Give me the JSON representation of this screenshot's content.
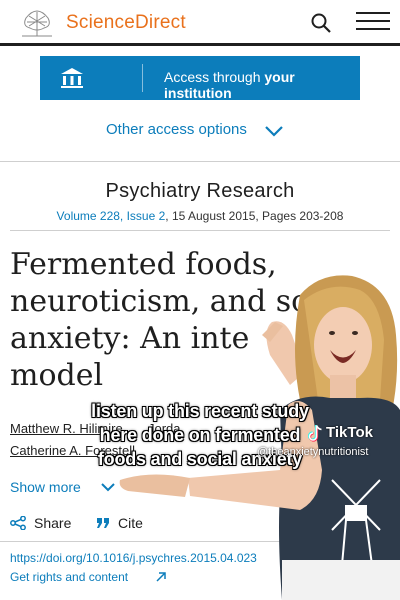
{
  "header": {
    "brand": "ScienceDirect",
    "brand_color": "#e9711c",
    "icons": [
      "elsevier-tree-logo",
      "search-icon",
      "menu-icon"
    ]
  },
  "access": {
    "prefix": "Access through ",
    "emphasis": "your institution",
    "other_options": "Other access options",
    "button_color": "#0c7dbb"
  },
  "journal": {
    "name": "Psychiatry Research",
    "volume_link": "Volume 228, Issue 2",
    "volume_rest": ", 15 August 2015, Pages 203-208"
  },
  "article": {
    "title_lines": [
      "Fermented foods,",
      "neuroticism, and so",
      "anxiety: An inte",
      "model"
    ],
    "authors_line1": "Matthew R. Hilimire",
    "authors_line1_tail": "       Jorda",
    "authors_line2": "Catherine A. Forestell",
    "show_more": "Show more",
    "share": "Share",
    "cite": "Cite",
    "doi": "https://doi.org/10.1016/j.psychres.2015.04.023",
    "rights": "Get rights and content"
  },
  "overlay": {
    "caption_lines": [
      "listen up this recent study",
      "here done on fermented",
      "foods and social anxiety"
    ],
    "platform": "TikTok",
    "handle": "@theanxietynutritionist"
  }
}
